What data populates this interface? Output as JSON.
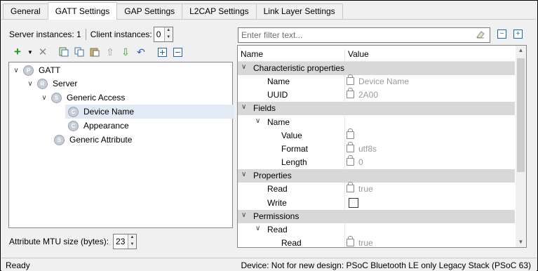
{
  "tabs": [
    "General",
    "GATT Settings",
    "GAP Settings",
    "L2CAP Settings",
    "Link Layer Settings"
  ],
  "active_tab": "GATT Settings",
  "instances": {
    "server_label": "Server instances: 1",
    "client_label": "Client instances:",
    "client_value": "0"
  },
  "toolbar_icons": [
    "add-icon",
    "dropdown-arrow-icon",
    "delete-icon",
    "import-icon",
    "copy-icon",
    "paste-icon",
    "move-up-icon",
    "move-down-icon",
    "undo-icon",
    "expand-all-icon",
    "collapse-all-icon"
  ],
  "tree": [
    {
      "label": "GATT",
      "badge": "P"
    },
    {
      "label": "Server",
      "badge": "R"
    },
    {
      "label": "Generic Access",
      "badge": "S"
    },
    {
      "label": "Device Name",
      "badge": "C",
      "selected": true
    },
    {
      "label": "Appearance",
      "badge": "C"
    },
    {
      "label": "Generic Attribute",
      "badge": "S"
    }
  ],
  "mtu": {
    "label": "Attribute MTU size (bytes):",
    "value": "23"
  },
  "filter": {
    "placeholder": "Enter filter text..."
  },
  "grid": {
    "col_name": "Name",
    "col_value": "Value",
    "rows": [
      {
        "type": "cat",
        "name": "Characteristic properties",
        "value": ""
      },
      {
        "type": "prop",
        "name": "Name",
        "value": "Device Name",
        "locked": true
      },
      {
        "type": "prop",
        "name": "UUID",
        "value": "2A00",
        "locked": true
      },
      {
        "type": "cat",
        "name": "Fields",
        "value": ""
      },
      {
        "type": "sub",
        "name": "Name",
        "value": ""
      },
      {
        "type": "prop2",
        "name": "Value",
        "value": "",
        "locked": true
      },
      {
        "type": "prop2",
        "name": "Format",
        "value": "utf8s",
        "locked": true
      },
      {
        "type": "prop2",
        "name": "Length",
        "value": "0",
        "locked": true
      },
      {
        "type": "cat",
        "name": "Properties",
        "value": ""
      },
      {
        "type": "prop",
        "name": "Read",
        "value": "true",
        "locked": true
      },
      {
        "type": "prop",
        "name": "Write",
        "value": "",
        "checkbox": true
      },
      {
        "type": "cat",
        "name": "Permissions",
        "value": ""
      },
      {
        "type": "sub",
        "name": "Read",
        "value": ""
      },
      {
        "type": "prop2",
        "name": "Read",
        "value": "true",
        "locked": true
      }
    ]
  },
  "status": {
    "left": "Ready",
    "right": "Device: Not for new design: PSoC Bluetooth LE only Legacy Stack (PSoC 63)"
  }
}
